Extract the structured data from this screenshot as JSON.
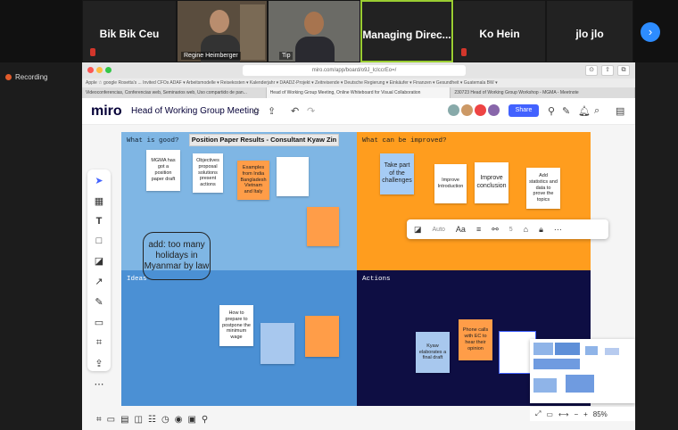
{
  "zoom": {
    "participants": [
      {
        "name": "Bik Bik Ceu",
        "video": false
      },
      {
        "name": "Regine Heimberger",
        "video": true
      },
      {
        "name": "Tip",
        "video": true
      },
      {
        "name": "Managing Direc...",
        "video": false
      },
      {
        "name": "Ko Hein",
        "video": false
      },
      {
        "name": "jlo jlo",
        "video": false
      }
    ],
    "recording_label": "Recording",
    "next_icon": "chevron-right-icon"
  },
  "browser": {
    "address": "miro.com/app/board/o9J_lcIccrEo=/",
    "bookmarks": "Apple ☆ google Rosetta's ... Invited CFOs ADAF ▾ Arbeitsmodelle ▾ Reisekosten ▾ Kalenderjahr ▾ DAADZ-Projekt ▾ Zeitreisende ▾ Deutsche Regierung ▾ Einkäufer ▾ Finanzen ▾ Gesundheit ▾ Guatemala BW ▾",
    "tabs": [
      {
        "label": "Videoconferencias, Conferencias web, Seminarios web, Uso compartido de pan...",
        "active": false
      },
      {
        "label": "Head of Working Group Meeting, Online Whiteboard for Visual Collaboration",
        "active": true
      },
      {
        "label": "230723 Head of Working Group Workshop - MGMA - Meetnote",
        "active": false
      }
    ]
  },
  "miro": {
    "logo": "miro",
    "board_title": "Head of Working Group Meeting",
    "share_label": "Share",
    "banner": "Position Paper Results - Consultant Kyaw Zin",
    "quadrants": {
      "good": "What is good?",
      "improve": "What can be improved?",
      "ideas": "Ideas",
      "actions": "Actions"
    },
    "stickies": {
      "g1": "MGMA has got a position paper draft",
      "g2": "Objectives proposal solutions present actions",
      "g3": "Examples from India Bangladesh Vietnam and Italy",
      "i1": "Take part of the challenges",
      "i2": "Improve Introduction",
      "i3": "Improve conclusion",
      "i4": "Add statistics and data to prove the topics",
      "d1": "How to prepare to postpone the minimum wage",
      "a1": "Kyaw elaborates a final draft",
      "a2": "Phone calls with EC to hear their opinion"
    },
    "bubble": "add: too many holidays in Myanmar by law",
    "ctx_toolbar": {
      "font": "Auto",
      "text_icon": "Aa",
      "size": "5"
    },
    "zoom_level": "85%"
  }
}
